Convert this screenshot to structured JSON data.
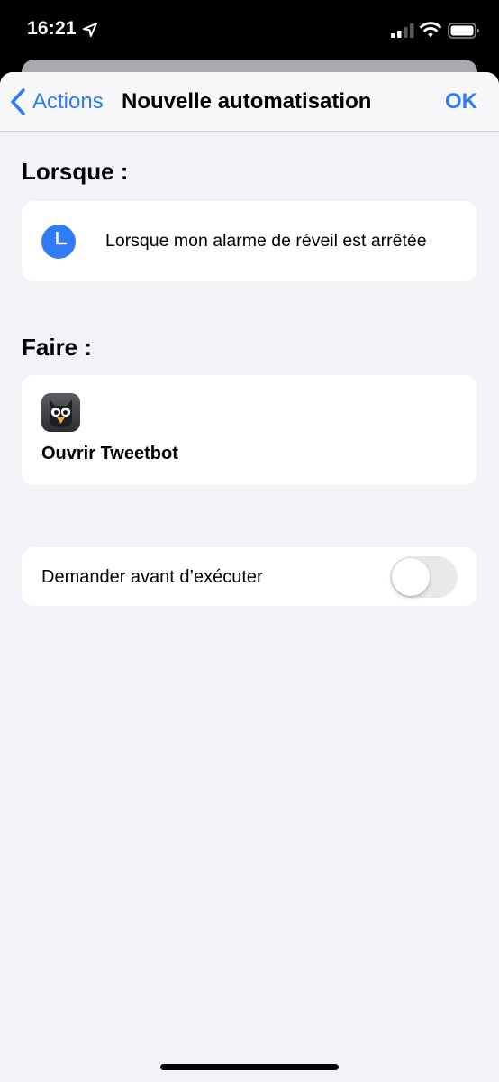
{
  "status_bar": {
    "time": "16:21",
    "icons": [
      "location-arrow-icon",
      "cellular-signal-icon",
      "wifi-icon",
      "battery-icon"
    ]
  },
  "nav": {
    "back_label": "Actions",
    "title": "Nouvelle automatisation",
    "ok_label": "OK"
  },
  "trigger_section": {
    "heading": "Lorsque :",
    "item": {
      "icon": "clock-icon",
      "text": "Lorsque mon alarme de réveil est arrêtée"
    }
  },
  "action_section": {
    "heading": "Faire :",
    "item": {
      "icon": "tweetbot-app-icon",
      "label": "Ouvrir Tweetbot"
    }
  },
  "ask_before_running": {
    "label": "Demander avant d’exécuter",
    "enabled": false
  },
  "colors": {
    "accent": "#2f7cf6",
    "background": "#f2f2f7",
    "card": "#ffffff",
    "toggle_off": "#e9e9eb"
  }
}
